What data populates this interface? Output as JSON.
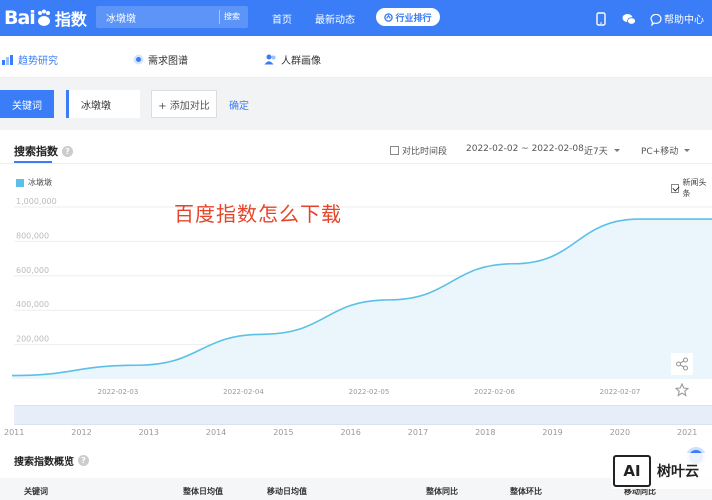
{
  "header": {
    "logo_latin": "Bai",
    "logo_du": "du",
    "logo_cn": "指数",
    "search_value": "冰墩墩",
    "search_button": "搜索",
    "nav": [
      "首页",
      "最新动态"
    ],
    "pill_label": "行业排行",
    "help_label": "帮助中心"
  },
  "subnav": {
    "items": [
      "趋势研究",
      "需求图谱",
      "人群画像"
    ]
  },
  "keywords": {
    "tab_label": "关键词",
    "keyword": "冰墩墩",
    "add_label": "+ 添加对比",
    "confirm_label": "确定"
  },
  "search_index": {
    "title": "搜索指数",
    "compare_label": "对比时间段",
    "date_range": "2022-02-02 ~ 2022-02-08",
    "period": "近7天",
    "device": "PC+移动",
    "legend": "冰墩墩",
    "news_label": "新闻头条",
    "overlay_text": "百度指数怎么下载"
  },
  "chart_data": {
    "type": "area",
    "y_ticks": [
      "1,000,000",
      "800,000",
      "600,000",
      "400,000",
      "200,000"
    ],
    "ylim": [
      0,
      1000000
    ],
    "x_ticks": [
      "2022-02-03",
      "2022-02-04",
      "2022-02-05",
      "2022-02-06",
      "2022-02-07"
    ],
    "grid": true,
    "series": [
      {
        "name": "冰墩墩",
        "color": "#5bc0e8",
        "x": [
          "2022-02-02",
          "2022-02-03",
          "2022-02-04",
          "2022-02-05",
          "2022-02-06",
          "2022-02-07",
          "2022-02-08"
        ],
        "values": [
          20000,
          80000,
          260000,
          460000,
          670000,
          930000,
          930000
        ]
      }
    ]
  },
  "timeline": {
    "years": [
      "2011",
      "2012",
      "2013",
      "2014",
      "2015",
      "2016",
      "2017",
      "2018",
      "2019",
      "2020",
      "2021"
    ]
  },
  "overview": {
    "title": "搜索指数概览",
    "columns": [
      "关键词",
      "整体日均值",
      "移动日均值",
      "整体同比",
      "整体环比",
      "移动同比"
    ]
  },
  "watermark": {
    "badge": "AI",
    "text": "树叶云"
  },
  "colors": {
    "brand": "#3a7df7",
    "series": "#5bc0e8",
    "overlay": "#e6452a"
  }
}
